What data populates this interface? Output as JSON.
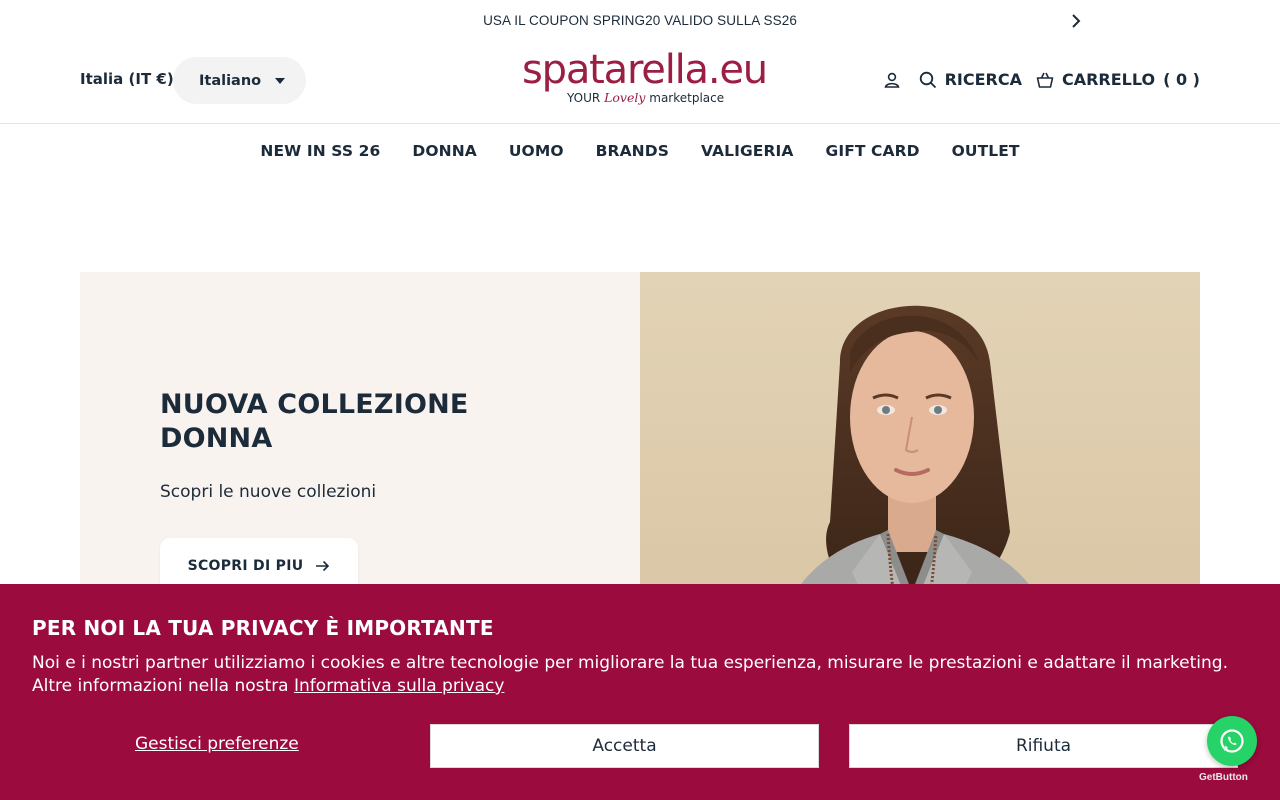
{
  "announcement": {
    "text": "USA IL COUPON SPRING20 VALIDO SULLA SS26"
  },
  "header": {
    "country": "Italia (IT €)",
    "language": "Italiano",
    "logo": {
      "main": "spatarella.eu",
      "tag_prefix": "YOUR",
      "tag_script": "Lovely",
      "tag_suffix": "marketplace"
    },
    "search_label": "RICERCA",
    "cart_label": "CARRELLO",
    "cart_count": "( 0 )"
  },
  "nav": {
    "items": [
      "NEW IN SS 26",
      "DONNA",
      "UOMO",
      "BRANDS",
      "VALIGERIA",
      "GIFT CARD",
      "OUTLET"
    ]
  },
  "hero": {
    "title": "NUOVA COLLEZIONE DONNA",
    "subtitle": "Scopri le nuove collezioni",
    "cta": "SCOPRI DI PIU"
  },
  "cookie_banner": {
    "title": "PER NOI LA TUA PRIVACY È IMPORTANTE",
    "text": "Noi e i nostri partner utilizziamo i cookies e altre tecnologie per migliorare la tua esperienza, misurare le prestazioni e adattare il marketing. Altre informazioni nella nostra ",
    "privacy_link": "Informativa sulla privacy",
    "preferences": "Gestisci preferenze",
    "accept": "Accetta",
    "reject": "Rifiuta"
  },
  "whatsapp": {
    "label": "GetButton"
  },
  "colors": {
    "brand": "#9b1e43",
    "cookie_bg": "#9b0b3e",
    "text": "#1c2b3a",
    "hero_bg": "#f9f3f0",
    "whatsapp": "#25d366"
  }
}
